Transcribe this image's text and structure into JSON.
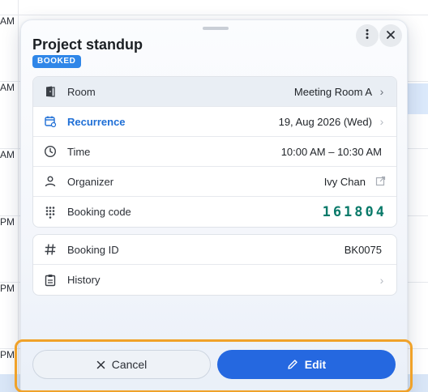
{
  "background": {
    "time_labels": [
      "AM",
      "AM",
      "AM",
      "PM",
      "PM",
      "PM"
    ]
  },
  "popover": {
    "title": "Project standup",
    "status_badge": "BOOKED",
    "more_icon": "more-vertical-icon",
    "close_icon": "close-icon",
    "details": [
      {
        "icon": "door-icon",
        "label": "Room",
        "value": "Meeting Room A",
        "chevron": true
      },
      {
        "icon": "calendar-repeat-icon",
        "label": "Recurrence",
        "value": "19, Aug 2026 (Wed)",
        "chevron": true
      },
      {
        "icon": "clock-icon",
        "label": "Time",
        "value": "10:00 AM – 10:30 AM",
        "chevron": false
      },
      {
        "icon": "person-icon",
        "label": "Organizer",
        "value": "Ivy Chan",
        "chevron": false
      },
      {
        "icon": "keypad-icon",
        "label": "Booking code",
        "value": "161804",
        "chevron": false
      }
    ],
    "meta": [
      {
        "icon": "hash-icon",
        "label": "Booking ID",
        "value": "BK0075"
      },
      {
        "icon": "clipboard-icon",
        "label": "History",
        "value": ""
      }
    ],
    "actions": {
      "cancel_label": "Cancel",
      "edit_label": "Edit"
    },
    "colors": {
      "badge": "#2f86e8",
      "link": "#1f6fd6",
      "code": "#0a7a6a",
      "primary": "#2568e0",
      "focus_outline": "#f0a229"
    }
  }
}
